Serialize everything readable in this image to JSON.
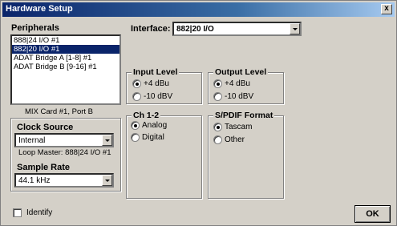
{
  "window": {
    "title": "Hardware Setup",
    "close_label": "x"
  },
  "peripherals": {
    "label": "Peripherals",
    "items": [
      {
        "label": "888|24 I/O #1",
        "selected": false
      },
      {
        "label": "882|20 I/O #1",
        "selected": true
      },
      {
        "label": "ADAT Bridge A [1-8] #1",
        "selected": false
      },
      {
        "label": "ADAT Bridge B [9-16] #1",
        "selected": false
      }
    ]
  },
  "mix_card_text": "MIX Card #1, Port B",
  "clock_source": {
    "label": "Clock Source",
    "value": "Internal",
    "loop_master": "Loop Master: 888|24 I/O #1"
  },
  "sample_rate": {
    "label": "Sample Rate",
    "value": "44.1 kHz"
  },
  "interface": {
    "label": "Interface:",
    "value": "882|20 I/O"
  },
  "input_level": {
    "label": "Input Level",
    "options": [
      "+4 dBu",
      "-10 dBV"
    ],
    "selected": 0
  },
  "output_level": {
    "label": "Output Level",
    "options": [
      "+4 dBu",
      "-10 dBV"
    ],
    "selected": 0
  },
  "ch12": {
    "label": "Ch 1-2",
    "options": [
      "Analog",
      "Digital"
    ],
    "selected": 0
  },
  "spdif": {
    "label": "S/PDIF Format",
    "options": [
      "Tascam",
      "Other"
    ],
    "selected": 0
  },
  "identify": {
    "label": "Identify",
    "checked": false
  },
  "ok_label": "OK",
  "colors": {
    "title_start": "#0a246a",
    "title_end": "#a6caf0",
    "face": "#d4d0c8",
    "selection": "#0a246a"
  }
}
